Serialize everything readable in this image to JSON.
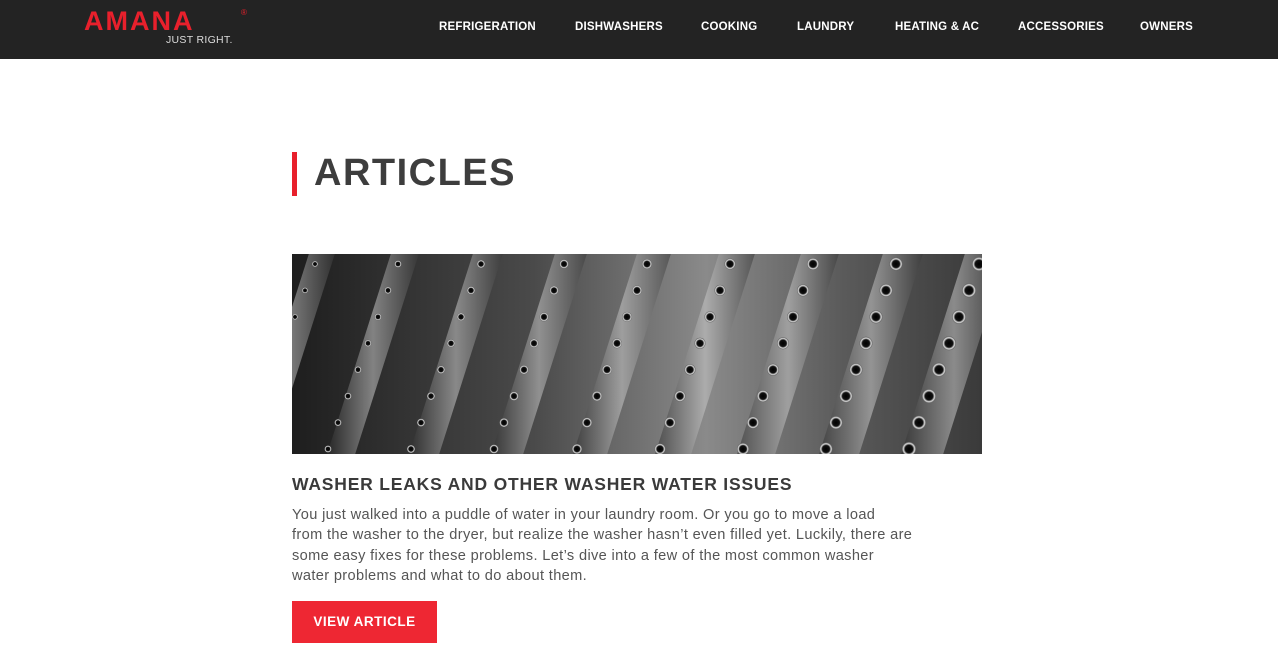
{
  "header": {
    "logo": {
      "wordmark": "AMANA",
      "registered": "®",
      "tagline": "JUST RIGHT."
    },
    "nav": [
      {
        "label": "REFRIGERATION"
      },
      {
        "label": "DISHWASHERS"
      },
      {
        "label": "COOKING"
      },
      {
        "label": "LAUNDRY"
      },
      {
        "label": "HEATING & AC"
      },
      {
        "label": "ACCESSORIES"
      },
      {
        "label": "OWNERS"
      }
    ]
  },
  "main": {
    "page_title": "ARTICLES",
    "article": {
      "image_icon": "washer-drum-image",
      "title": "WASHER LEAKS AND OTHER WASHER WATER ISSUES",
      "body_lines": [
        "You just walked into a puddle of water in your laundry room. Or you go to move a load",
        "from the washer to the dryer, but realize the washer hasn’t even filled yet. Luckily, there are",
        "some easy fixes for these problems. Let’s dive into a few of the most common washer",
        "water problems and what to do about them."
      ],
      "button_label": "VIEW ARTICLE"
    }
  },
  "colors": {
    "brand_red": "#e8202c",
    "header_bg": "#232323",
    "button_red": "#ee2733",
    "text_dark": "#3a3a3a"
  }
}
